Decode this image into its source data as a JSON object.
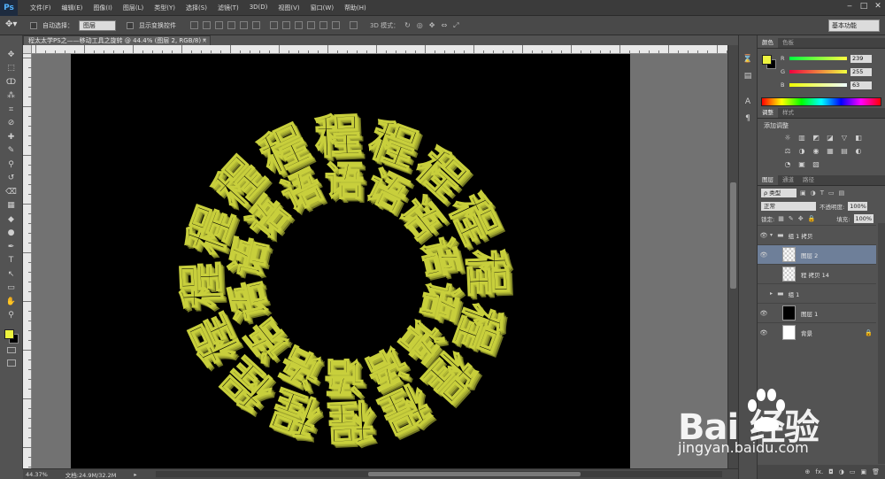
{
  "app": {
    "logo": "Ps"
  },
  "menu": [
    "文件(F)",
    "编辑(E)",
    "图像(I)",
    "图层(L)",
    "类型(Y)",
    "选择(S)",
    "滤镜(T)",
    "3D(D)",
    "视图(V)",
    "窗口(W)",
    "帮助(H)"
  ],
  "window_controls": [
    "‒",
    "□",
    "✕"
  ],
  "options": {
    "auto_select_label": "自动选择：",
    "auto_select_value": "图层",
    "show_transform_label": "显示变换控件",
    "mode_3d_label": "3D 模式：",
    "workspace": "基本功能"
  },
  "document": {
    "tab_title": "程太太学PS之——移动工具之旋转 @ 44.4% (图层 2, RGB/8) *",
    "close": "×"
  },
  "canvas_art": {
    "outer_char": "程",
    "inner_char": "语",
    "text_color": "#c8cf3c",
    "outer_count": 16,
    "inner_count": 14
  },
  "status": {
    "zoom": "44.37%",
    "doc_size": "文档:24.9M/32.2M"
  },
  "tool_icons": [
    "move-icon",
    "marquee-icon",
    "lasso-icon",
    "quick-select-icon",
    "crop-icon",
    "eyedropper-icon",
    "healing-icon",
    "brush-icon",
    "stamp-icon",
    "history-brush-icon",
    "eraser-icon",
    "gradient-icon",
    "blur-icon",
    "dodge-icon",
    "pen-icon",
    "type-icon",
    "path-select-icon",
    "shape-icon",
    "hand-icon",
    "zoom-icon"
  ],
  "tool_glyphs": [
    "✥",
    "⬚",
    "ↀ",
    "⁂",
    "⌗",
    "⊘",
    "✚",
    "✎",
    "⚲",
    "↺",
    "⌫",
    "▦",
    "◆",
    "●",
    "✒",
    "T",
    "↖",
    "▭",
    "✋",
    "⚲"
  ],
  "color_panel": {
    "tabs": [
      "颜色",
      "色板"
    ],
    "channels": [
      {
        "label": "R",
        "value": "239"
      },
      {
        "label": "G",
        "value": "255"
      },
      {
        "label": "B",
        "value": "63"
      }
    ],
    "fg_color": "#eef43f",
    "bg_color": "#000000"
  },
  "adjust_panel": {
    "tabs": [
      "调整",
      "样式"
    ],
    "title": "添加调整",
    "icon_glyphs": [
      "☼",
      "▥",
      "◩",
      "◪",
      "▽",
      "◧",
      "⚖",
      "◑",
      "◉",
      "▦",
      "▤",
      "◐",
      "◔",
      "▣",
      "▧"
    ]
  },
  "layers_panel": {
    "tabs": [
      "图层",
      "通道",
      "路径"
    ],
    "kind_label": "ρ 类型",
    "blend_mode": "正常",
    "opacity_label": "不透明度:",
    "opacity_value": "100%",
    "lock_label": "锁定:",
    "fill_label": "填充:",
    "fill_value": "100%",
    "layers": [
      {
        "name": "组 1 拷贝",
        "visible": true,
        "type": "group-open",
        "selected": false,
        "thumb": "none"
      },
      {
        "name": "图层 2",
        "visible": true,
        "type": "layer",
        "selected": true,
        "thumb": "transparent"
      },
      {
        "name": "程 拷贝 14",
        "visible": false,
        "type": "layer",
        "selected": false,
        "thumb": "transparent"
      },
      {
        "name": "组 1",
        "visible": false,
        "type": "group",
        "selected": false,
        "thumb": "none"
      },
      {
        "name": "图层 1",
        "visible": true,
        "type": "layer",
        "selected": false,
        "thumb": "#000000"
      },
      {
        "name": "背景",
        "visible": true,
        "type": "layer",
        "selected": false,
        "thumb": "#ffffff",
        "locked": true
      }
    ],
    "footer_icons": [
      "⊕",
      "fx.",
      "◘",
      "◑",
      "▭",
      "▣",
      "🗑"
    ]
  },
  "watermark": {
    "brand": "Bai  经验",
    "url": "jingyan.baidu.com"
  }
}
